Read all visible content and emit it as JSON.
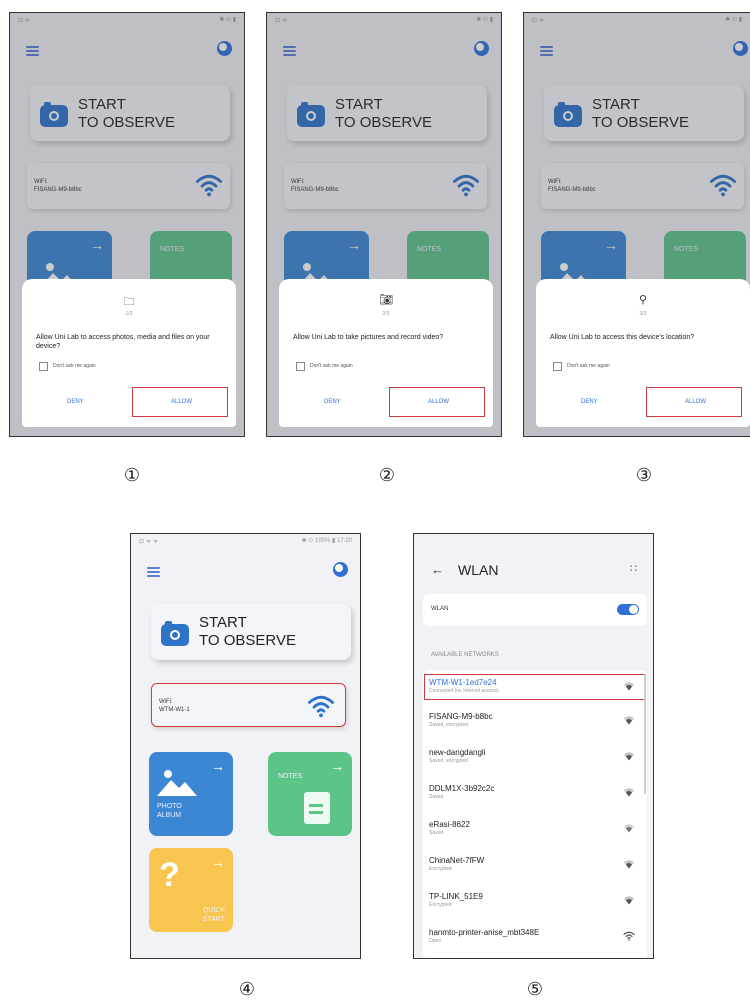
{
  "screens": {
    "common": {
      "start_line1": "START",
      "start_line2": "TO OBSERVE",
      "wifi_label": "WiFi:",
      "deny": "DENY",
      "allow": "ALLOW",
      "dont_ask": "Don't ask me again",
      "photo_album_line1": "PHOTO",
      "photo_album_line2": "ALBUM",
      "notes": "NOTES",
      "quick_line1": "QUICK",
      "quick_line2": "START"
    },
    "s1": {
      "number": "①",
      "wifi_ssid": "FISANG-M9-b8bc",
      "step": "1/3",
      "prompt": "Allow Uni Lab to access photos, media and files on your device?",
      "dialog_icon": "folder-icon"
    },
    "s2": {
      "number": "②",
      "wifi_ssid": "FISANG-M9-b8bc",
      "step": "2/3",
      "prompt": "Allow Uni Lab to take pictures and record video?",
      "dialog_icon": "camera-icon"
    },
    "s3": {
      "number": "③",
      "wifi_ssid": "FISANG-M9-b8bc",
      "step": "3/3",
      "prompt": "Allow Uni Lab to access this device's location?",
      "dialog_icon": "location-icon"
    },
    "s4": {
      "number": "④",
      "status_left": "⊡ ᯤ ᯤ",
      "status_right": "✱ ⬭ 100% ▮ 17:20",
      "wifi_ssid": "WTM-W1-1"
    },
    "s5": {
      "number": "⑤",
      "title": "WLAN",
      "wlan_label": "WLAN",
      "section": "AVAILABLE NETWORKS",
      "networks": [
        {
          "name": "WTM-W1-1ed7e24",
          "sub": "Connected (no Internet access)"
        },
        {
          "name": "FISANG-M9-b8bc",
          "sub": "Saved, encrypted"
        },
        {
          "name": "new-dangdangli",
          "sub": "Saved, encrypted"
        },
        {
          "name": "DDLM1X-3b92c2c",
          "sub": "Saved"
        },
        {
          "name": "eRasi-8622",
          "sub": "Saved"
        },
        {
          "name": "ChinaNet-7fFW",
          "sub": "Encrypted"
        },
        {
          "name": "TP-LINK_51E9",
          "sub": "Encrypted"
        },
        {
          "name": "hanmto-printer-anise_mbt348E",
          "sub": "Open"
        }
      ]
    }
  },
  "colors": {
    "accent": "#2f6fd6",
    "highlight": "#d23b3b",
    "photo": "#3b87d3",
    "notes": "#5cc489",
    "quick": "#f7c550"
  }
}
